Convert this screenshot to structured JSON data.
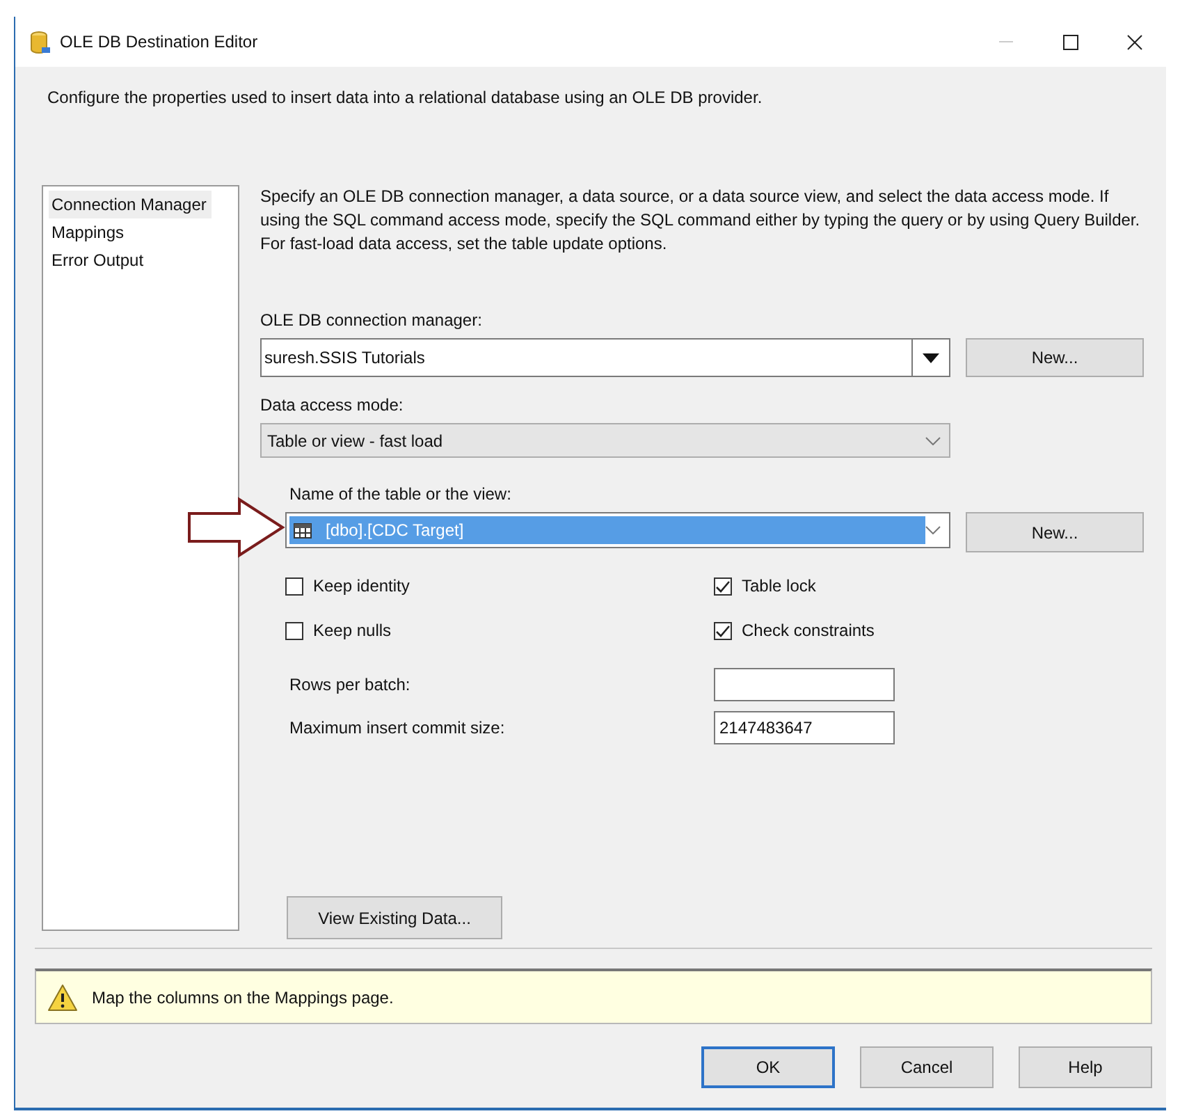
{
  "window": {
    "title": "OLE DB Destination Editor"
  },
  "header": {
    "description": "Configure the properties used to insert data into a relational database using an OLE DB provider."
  },
  "sidebar": {
    "items": [
      {
        "label": "Connection Manager",
        "selected": true
      },
      {
        "label": "Mappings",
        "selected": false
      },
      {
        "label": "Error Output",
        "selected": false
      }
    ]
  },
  "content": {
    "description": "Specify an OLE DB connection manager, a data source, or a data source view, and select the data access mode. If using the SQL command access mode, specify the SQL command either by typing the query or by using Query Builder. For fast-load data access, set the table update options.",
    "connection_manager": {
      "label": "OLE DB connection manager:",
      "value": "suresh.SSIS Tutorials",
      "button": "New..."
    },
    "data_access_mode": {
      "label": "Data access mode:",
      "value": "Table or view - fast load"
    },
    "table_name": {
      "label": "Name of the table or the view:",
      "value": "[dbo].[CDC Target]",
      "selected": true,
      "button": "New..."
    },
    "options": [
      {
        "label": "Keep identity",
        "checked": false
      },
      {
        "label": "Table lock",
        "checked": true
      },
      {
        "label": "Keep nulls",
        "checked": false
      },
      {
        "label": "Check constraints",
        "checked": true
      }
    ],
    "fields": [
      {
        "label": "Rows per batch:"
      },
      {
        "label": "Maximum insert commit size:",
        "value": "2147483647"
      }
    ],
    "view_button": "View Existing Data..."
  },
  "message": {
    "text": "Map the columns on the Mappings page."
  },
  "buttons": [
    {
      "label": "OK",
      "default": true
    },
    {
      "label": "Cancel",
      "default": false
    },
    {
      "label": "Help",
      "default": false
    }
  ]
}
